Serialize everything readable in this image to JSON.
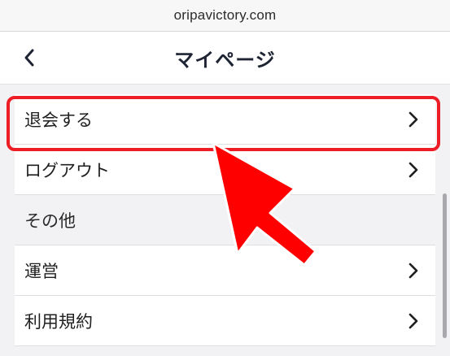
{
  "browser": {
    "url": "oripavictory.com"
  },
  "header": {
    "title": "マイページ",
    "back_icon": "chevron-left-icon"
  },
  "menu": {
    "items": [
      {
        "label": "退会する",
        "icon": "chevron-right-icon",
        "highlighted": true
      },
      {
        "label": "ログアウト",
        "icon": "chevron-right-icon"
      }
    ],
    "section": {
      "label": "その他"
    },
    "other_items": [
      {
        "label": "運営",
        "icon": "chevron-right-icon"
      },
      {
        "label": "利用規約",
        "icon": "chevron-right-icon"
      }
    ]
  },
  "annotation": {
    "highlight_color": "#ee1c24",
    "arrow_color": "#ee1c24"
  }
}
